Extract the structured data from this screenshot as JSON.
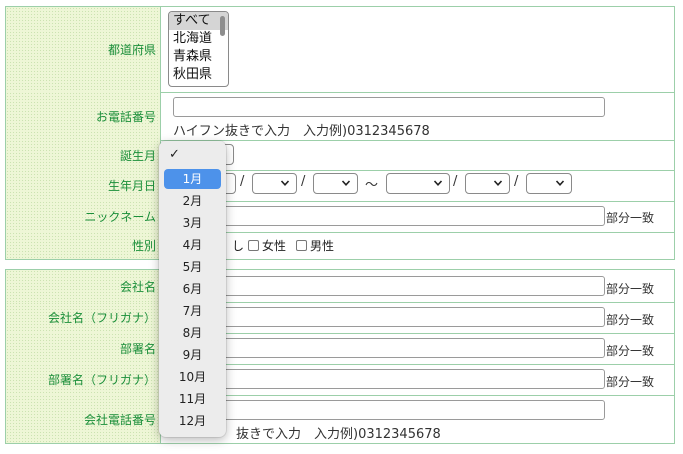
{
  "section1": {
    "prefecture": {
      "label": "都道府県",
      "options": [
        "すべて",
        "北海道",
        "青森県",
        "秋田県"
      ],
      "selected_index": 0
    },
    "phone": {
      "label": "お電話番号",
      "value": "",
      "hint": "ハイフン抜きで入力　入力例)0312345678"
    },
    "birth_month": {
      "label": "誕生月",
      "value": ""
    },
    "birthdate": {
      "label": "生年月日",
      "slash": "/",
      "tilde": "〜"
    },
    "nickname": {
      "label": "ニックネーム",
      "value": "",
      "match": "部分一致"
    },
    "gender": {
      "label": "性別",
      "options": [
        "指定なし",
        "女性",
        "男性"
      ],
      "visible_tail_0": "し"
    }
  },
  "section2": {
    "company": {
      "label": "会社名",
      "value": "",
      "match": "部分一致"
    },
    "company_kana": {
      "label": "会社名（フリガナ）",
      "value": "",
      "match": "部分一致"
    },
    "department": {
      "label": "部署名",
      "value": "",
      "match": "部分一致"
    },
    "department_kana": {
      "label": "部署名（フリガナ）",
      "value": "",
      "match": "部分一致"
    },
    "company_phone": {
      "label": "会社電話番号",
      "value": "",
      "hint": "ハイフン抜きで入力　入力例)0312345678",
      "visible_hint_tail": "抜きで入力　入力例)0312345678"
    }
  },
  "month_dropdown": {
    "check": "✓",
    "items": [
      "1月",
      "2月",
      "3月",
      "4月",
      "5月",
      "6月",
      "7月",
      "8月",
      "9月",
      "10月",
      "11月",
      "12月"
    ],
    "highlighted_index": 0
  },
  "colors": {
    "border": "#9ccfa9",
    "label_text": "#1b8f3a",
    "label_bg": "#eef6d6",
    "highlight": "#4d92ea"
  }
}
